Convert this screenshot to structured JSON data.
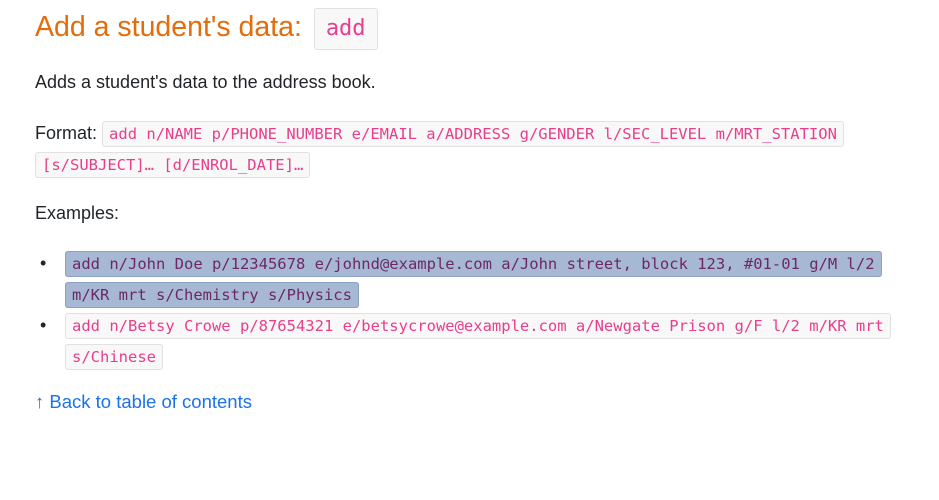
{
  "heading": {
    "text": "Add a student's data:",
    "command": "add"
  },
  "description": "Adds a student's data to the address book.",
  "format": {
    "label": "Format:",
    "code": "add n/NAME p/PHONE_NUMBER e/EMAIL a/ADDRESS g/GENDER l/SEC_LEVEL m/MRT_STATION [s/SUBJECT]… [d/ENROL_DATE]…"
  },
  "examples": {
    "label": "Examples:",
    "items": [
      {
        "code": "add n/John Doe p/12345678 e/johnd@example.com a/John street, block 123, #01-01 g/M l/2 m/KR mrt s/Chemistry s/Physics",
        "selected": true
      },
      {
        "code": "add n/Betsy Crowe p/87654321 e/betsycrowe@example.com a/Newgate Prison g/F l/2 m/KR mrt s/Chinese",
        "selected": false
      }
    ],
    "bullet": "•"
  },
  "back_link": "↑ Back to table of contents",
  "colors": {
    "heading": "#e46c0a",
    "code_text": "#e83e8c",
    "code_bg": "#f8f8f8",
    "selection_bg": "#a7b8d4",
    "link": "#1a73e8"
  }
}
